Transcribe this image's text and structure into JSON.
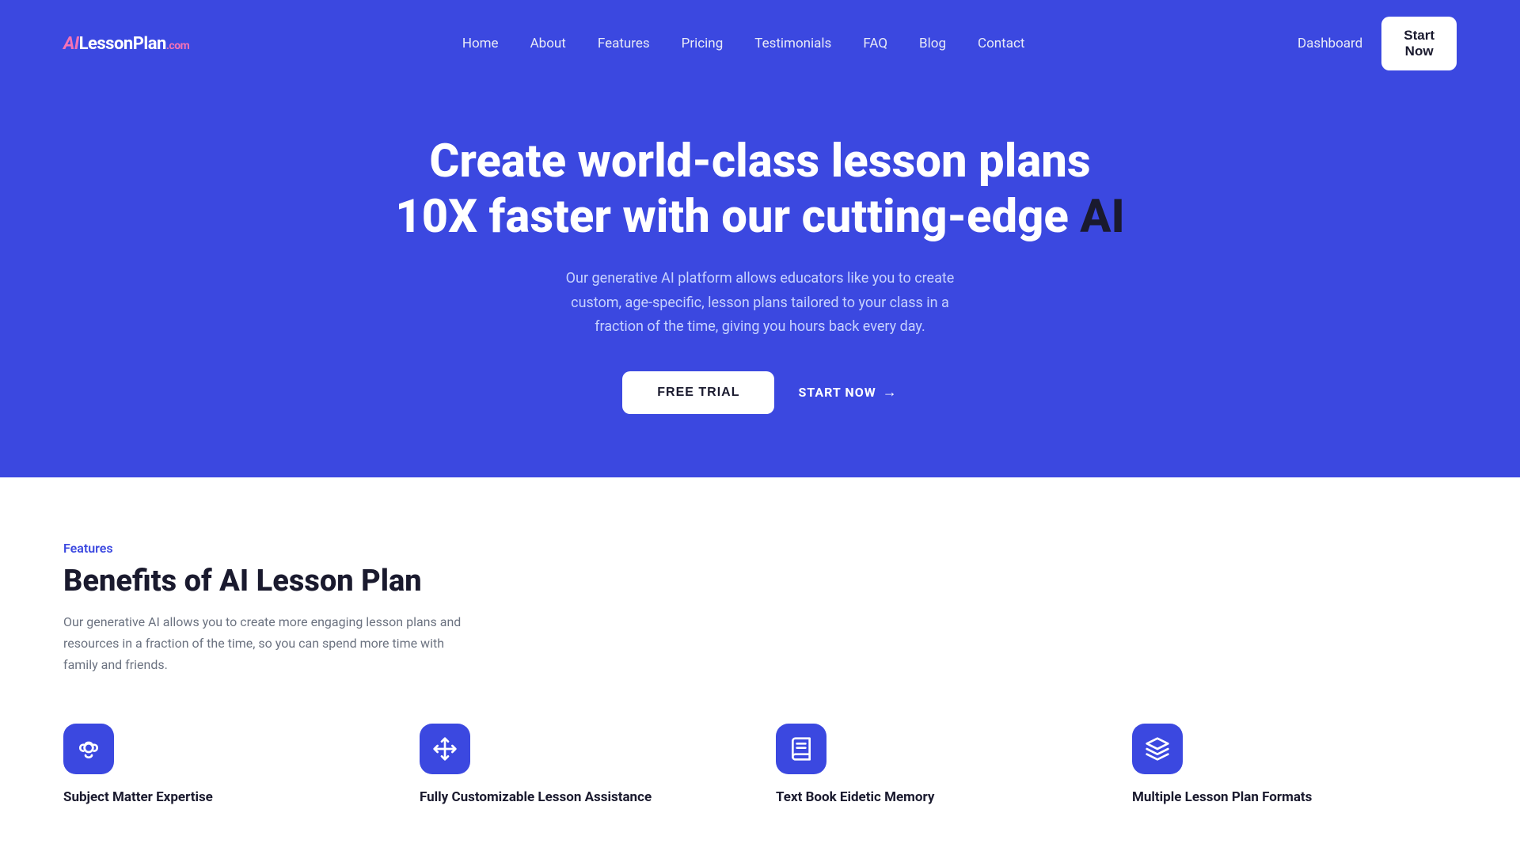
{
  "header": {
    "logo": {
      "prefix": "AI",
      "main": "LessonPlan",
      "suffix": ".com"
    },
    "nav": {
      "items": [
        {
          "label": "Home",
          "href": "#"
        },
        {
          "label": "About",
          "href": "#"
        },
        {
          "label": "Features",
          "href": "#"
        },
        {
          "label": "Pricing",
          "href": "#"
        },
        {
          "label": "Testimonials",
          "href": "#"
        },
        {
          "label": "FAQ",
          "href": "#"
        },
        {
          "label": "Blog",
          "href": "#"
        },
        {
          "label": "Contact",
          "href": "#"
        }
      ]
    },
    "dashboard_label": "Dashboard",
    "start_now_label": "Start\nNow"
  },
  "hero": {
    "headline_part1": "Create world-class lesson plans",
    "headline_part2": "10X faster with our cutting-edge ",
    "headline_ai": "AI",
    "description": "Our generative AI platform allows educators like you to create custom, age-specific, lesson plans tailored to your class in a fraction of the time, giving you hours back every day.",
    "free_trial_label": "FREE TRIAL",
    "start_now_label": "START NOW"
  },
  "features": {
    "section_label": "Features",
    "title": "Benefits of AI Lesson Plan",
    "description": "Our generative AI allows you to create more engaging lesson plans and resources in a fraction of the time, so you can spend more time with family and friends.",
    "cards": [
      {
        "icon": "brain",
        "title": "Subject Matter Expertise"
      },
      {
        "icon": "move",
        "title": "Fully Customizable Lesson Assistance"
      },
      {
        "icon": "book",
        "title": "Text Book Eidetic Memory"
      },
      {
        "icon": "layers",
        "title": "Multiple Lesson Plan Formats"
      }
    ]
  },
  "colors": {
    "primary": "#3b48e0",
    "dark": "#1a1a2e",
    "white": "#ffffff"
  }
}
